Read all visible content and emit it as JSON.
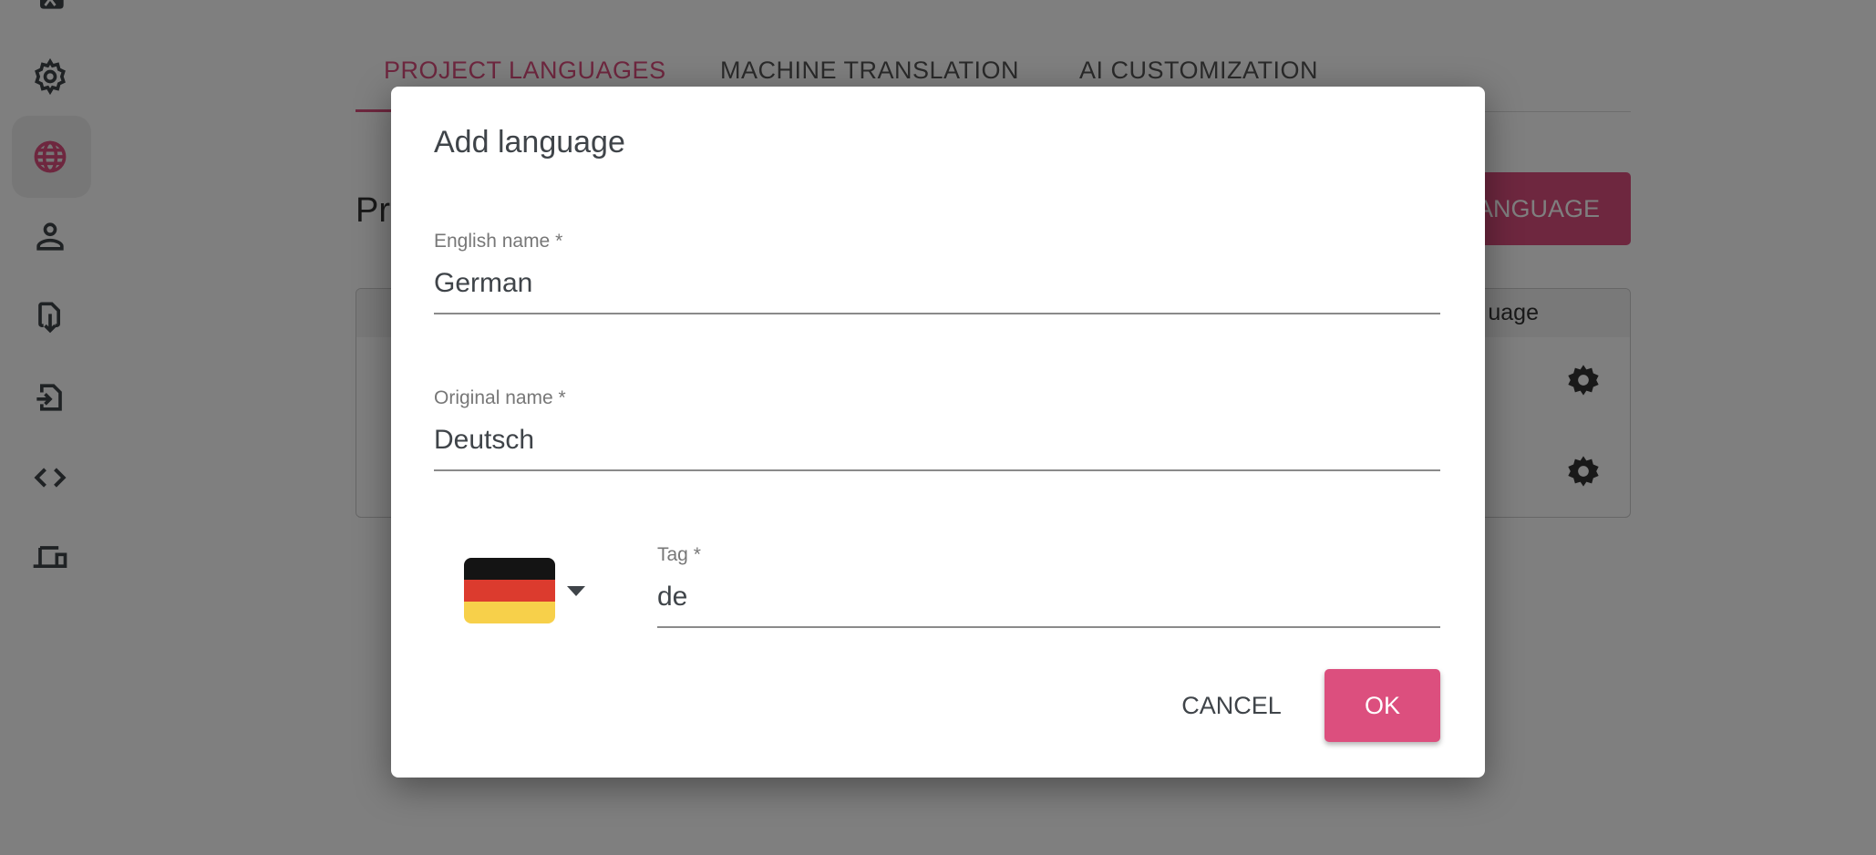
{
  "sidebar": {
    "items": [
      {
        "icon": "translate-screen-icon"
      },
      {
        "icon": "gear-icon"
      },
      {
        "icon": "globe-icon",
        "active": true
      },
      {
        "icon": "person-icon"
      },
      {
        "icon": "file-download-icon"
      },
      {
        "icon": "file-import-icon"
      },
      {
        "icon": "code-icon"
      },
      {
        "icon": "devices-icon"
      }
    ]
  },
  "tabs": [
    {
      "label": "PROJECT LANGUAGES",
      "active": true
    },
    {
      "label": "MACHINE TRANSLATION"
    },
    {
      "label": "AI CUSTOMIZATION"
    }
  ],
  "page": {
    "heading_partial": "Pr",
    "add_button_partial": "ANGUAGE",
    "table_header_partial": "uage"
  },
  "dialog": {
    "title": "Add language",
    "english_name": {
      "label": "English name *",
      "value": "German"
    },
    "original_name": {
      "label": "Original name *",
      "value": "Deutsch"
    },
    "flag": "germany",
    "tag": {
      "label": "Tag *",
      "value": "de"
    },
    "cancel_label": "CANCEL",
    "ok_label": "OK"
  },
  "colors": {
    "accent": "#dc4f7e",
    "overlay": "rgba(0,0,0,0.5)"
  }
}
